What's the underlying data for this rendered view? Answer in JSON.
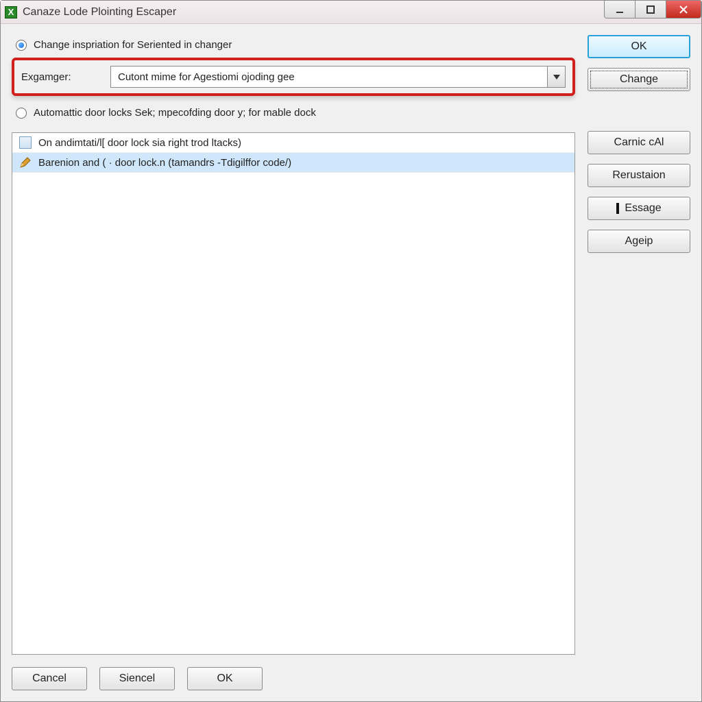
{
  "window": {
    "title": "Canaze Lode Plointing Escaper",
    "app_icon_glyph": "X"
  },
  "radios": {
    "option1_label": "Change inspriation for Seriented in changer",
    "option2_label": "Automattic door locks Sek; mpecofding door y; for mable dock",
    "selected": 1
  },
  "field": {
    "label": "Exgamger:",
    "combo_value": "Cutont mime for Agestiomi ojoding gee"
  },
  "list": {
    "items": [
      {
        "icon": "box",
        "text": "On andimtati/l[ door lock sia right trod ltacks)"
      },
      {
        "icon": "pencil",
        "text": "Barenion and ( · door lock.n (tamandrs -Tdigilffor code/)"
      }
    ],
    "selected_index": 1
  },
  "right_buttons": {
    "ok": "OK",
    "change": "Change",
    "carnic": "Carnic cAl",
    "rerustaion": "Rerustaion",
    "essage": "Essage",
    "ageip": "Ageip"
  },
  "bottom_buttons": {
    "cancel": "Cancel",
    "siencel": "Siencel",
    "ok": "OK"
  }
}
